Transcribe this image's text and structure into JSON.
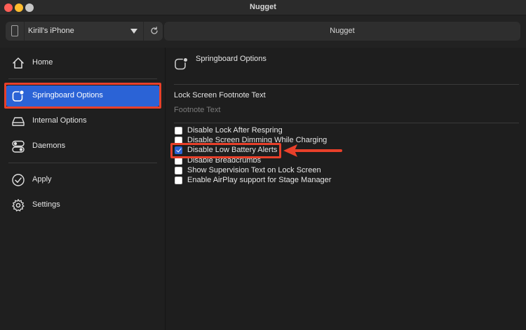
{
  "window": {
    "title": "Nugget"
  },
  "toolbar": {
    "device_name": "Kirill's iPhone",
    "field_text": "Nugget",
    "device_icon": "phone-icon",
    "refresh_icon": "refresh-icon"
  },
  "sidebar": {
    "items": [
      {
        "label": "Home",
        "icon": "house-icon"
      },
      {
        "label": "Springboard Options",
        "icon": "springboard-icon",
        "selected": true
      },
      {
        "label": "Internal Options",
        "icon": "drive-icon"
      },
      {
        "label": "Daemons",
        "icon": "toggles-icon"
      },
      {
        "label": "Apply",
        "icon": "checkmark-circle-icon"
      },
      {
        "label": "Settings",
        "icon": "gear-icon"
      }
    ]
  },
  "main": {
    "title": "Springboard Options",
    "footnote_label": "Lock Screen Footnote Text",
    "footnote_placeholder": "Footnote Text",
    "options": [
      {
        "label": "Disable Lock After Respring",
        "checked": false
      },
      {
        "label": "Disable Screen Dimming While Charging",
        "checked": false
      },
      {
        "label": "Disable Low Battery Alerts",
        "checked": true
      },
      {
        "label": "Disable Breadcrumbs",
        "checked": false
      },
      {
        "label": "Show Supervision Text on Lock Screen",
        "checked": false
      },
      {
        "label": "Enable AirPlay support for Stage Manager",
        "checked": false
      }
    ]
  },
  "colors": {
    "accent": "#2b63d6",
    "annotation": "#e8402a",
    "background": "#1e1e1e"
  }
}
